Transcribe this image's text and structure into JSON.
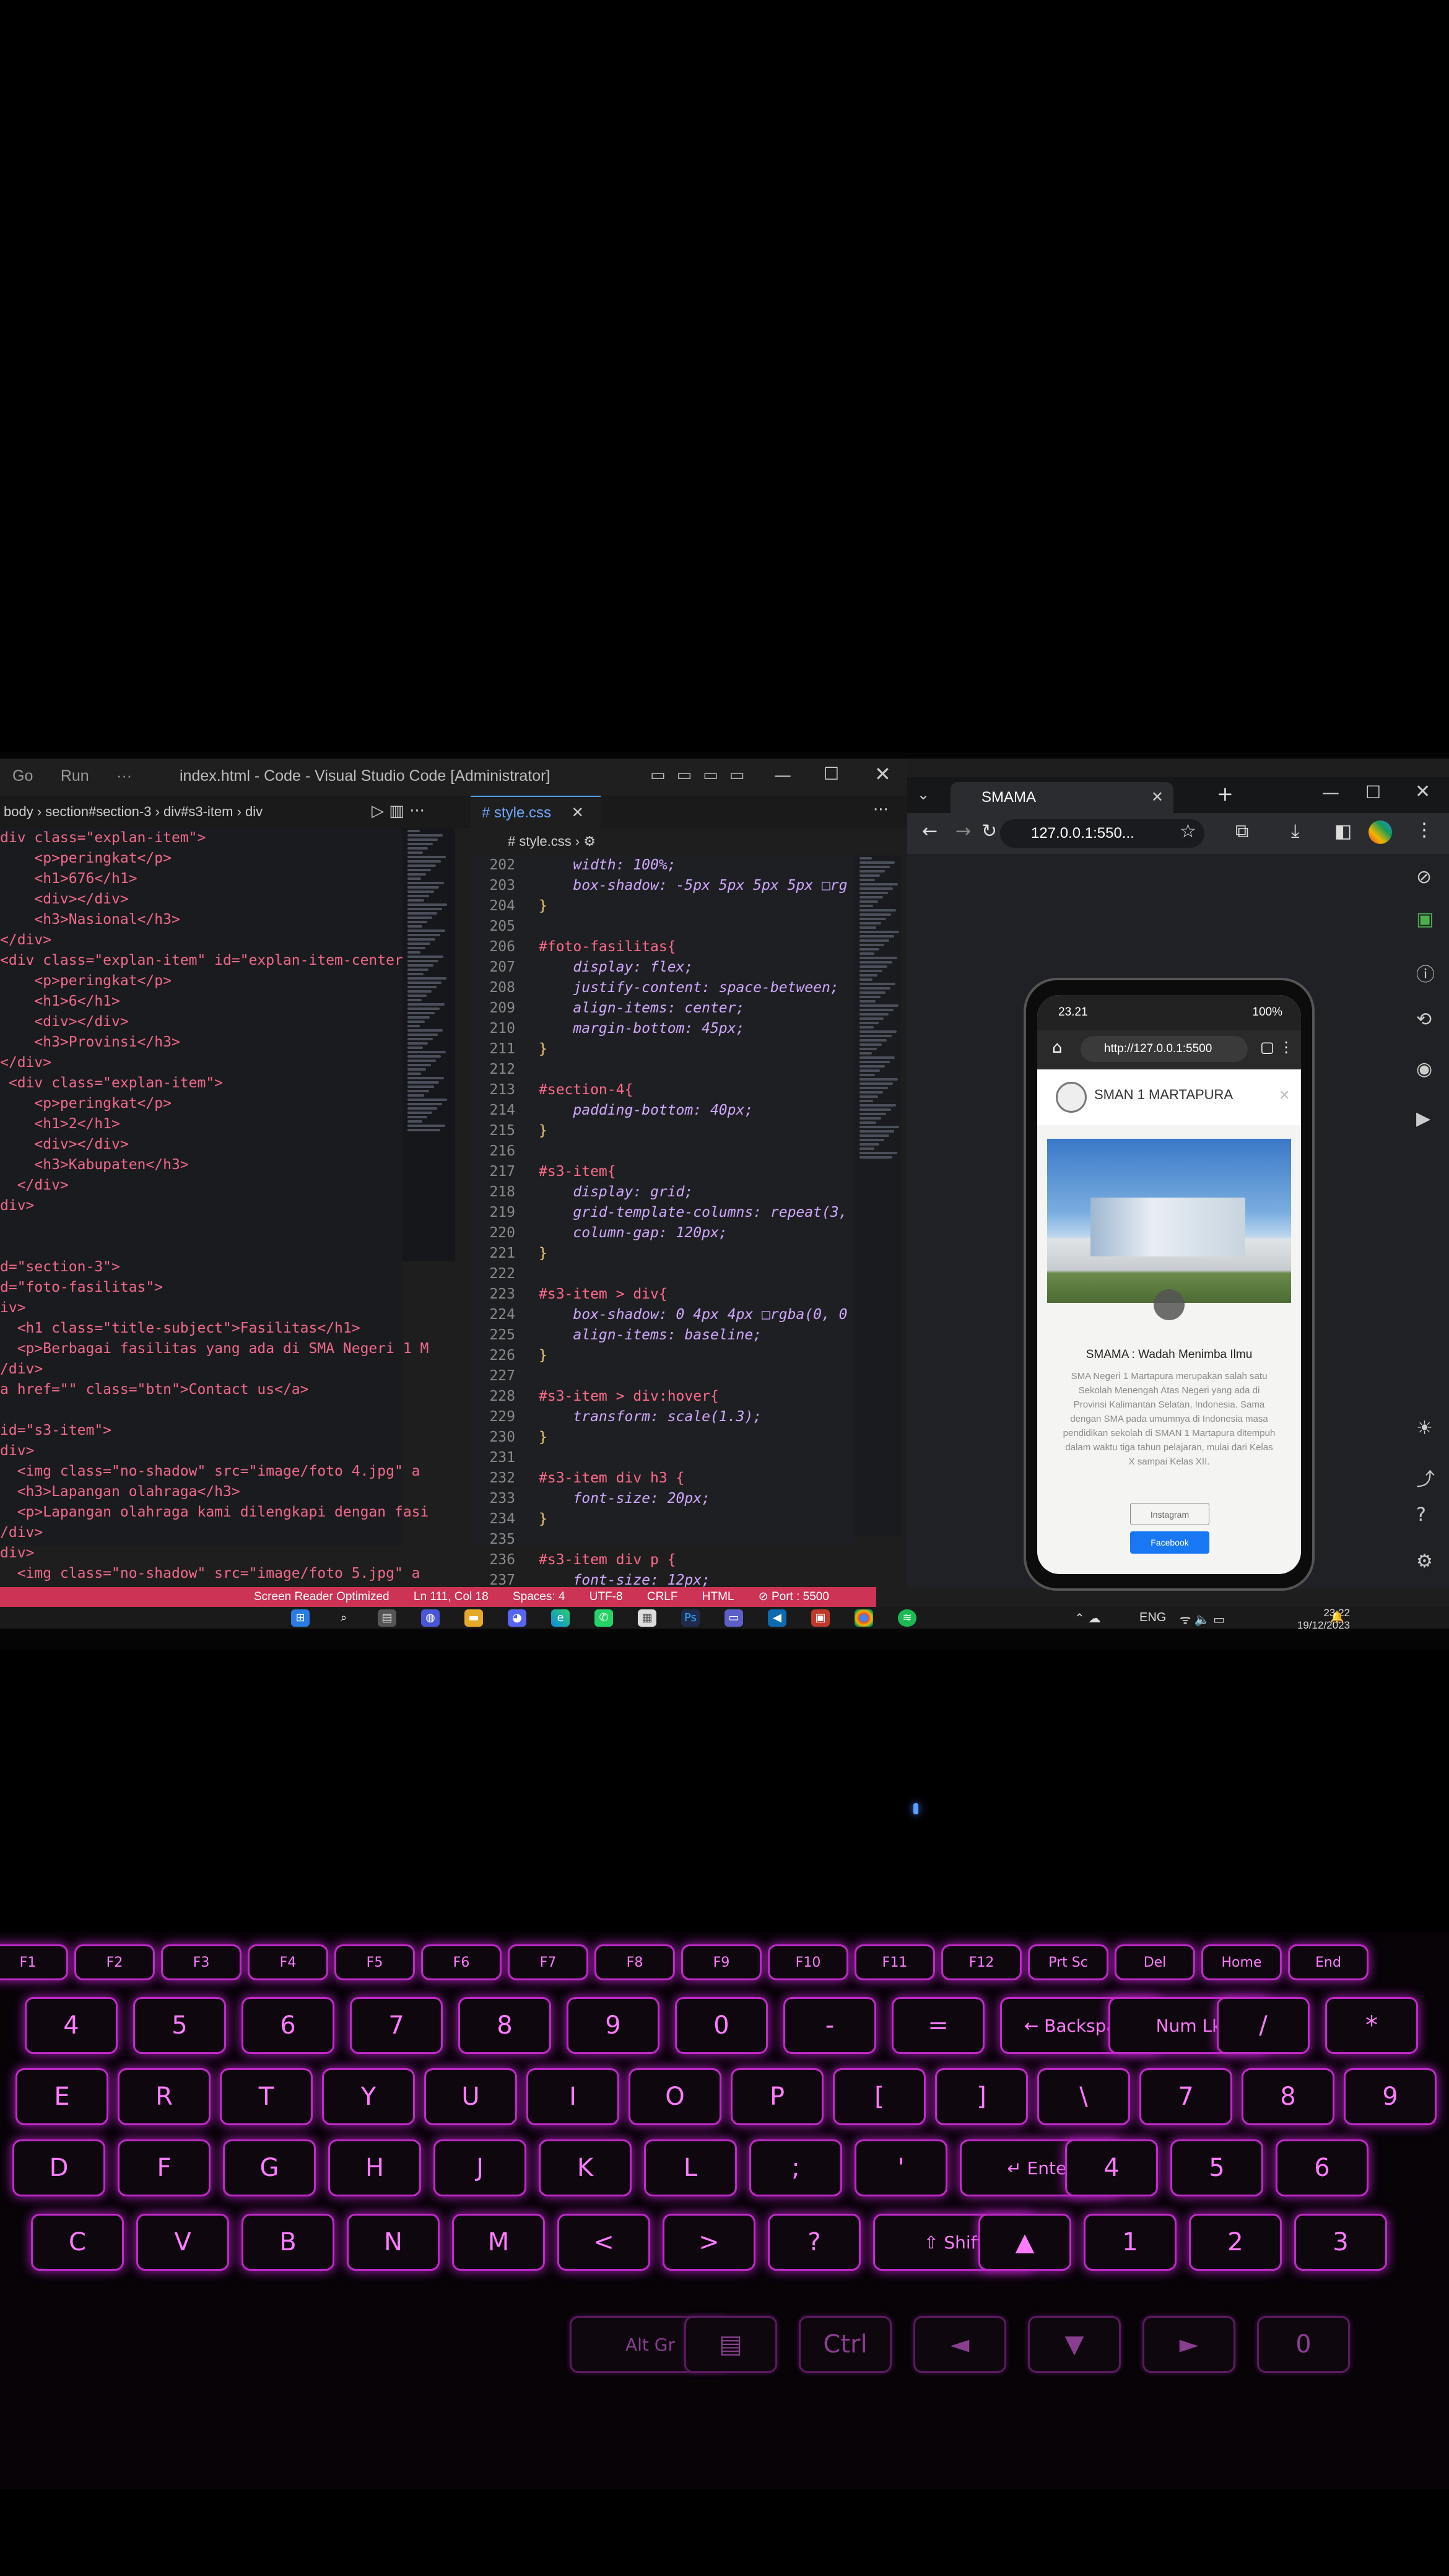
{
  "vscode": {
    "title": "index.html - Code - Visual Studio Code [Administrator]",
    "menu": [
      "Go",
      "Run",
      "···"
    ],
    "breadcrumb": "body › section#section-3 › div#s3-item › div",
    "html_lines": [
      "div class=\"explan-item\">",
      "    <p>peringkat</p>",
      "    <h1>676</h1>",
      "    <div></div>",
      "    <h3>Nasional</h3>",
      "</div>",
      "<div class=\"explan-item\" id=\"explan-item-center\"",
      "    <p>peringkat</p>",
      "    <h1>6</h1>",
      "    <div></div>",
      "    <h3>Provinsi</h3>",
      "</div>",
      " <div class=\"explan-item\">",
      "    <p>peringkat</p>",
      "    <h1>2</h1>",
      "    <div></div>",
      "    <h3>Kabupaten</h3>",
      "  </div>",
      "div>",
      "",
      "",
      "d=\"section-3\">",
      "d=\"foto-fasilitas\">",
      "iv>",
      "  <h1 class=\"title-subject\">Fasilitas</h1>",
      "  <p>Berbagai fasilitas yang ada di SMA Negeri 1 M",
      "/div>",
      "a href=\"\" class=\"btn\">Contact us</a>",
      "",
      "id=\"s3-item\">",
      "div>",
      "  <img class=\"no-shadow\" src=\"image/foto 4.jpg\" a",
      "  <h3>Lapangan olahraga</h3>",
      "  <p>Lapangan olahraga kami dilengkapi dengan fasi",
      "/div>",
      "div>",
      "  <img class=\"no-shadow\" src=\"image/foto 5.jpg\" a"
    ],
    "css_tab": "style.css",
    "css_breadcrumb": "# style.css › ⚙",
    "css_lines": [
      {
        "n": "202",
        "t": "    width: 100%;"
      },
      {
        "n": "203",
        "t": "    box-shadow: -5px 5px 5px 5px □rg"
      },
      {
        "n": "204",
        "t": "}"
      },
      {
        "n": "205",
        "t": ""
      },
      {
        "n": "206",
        "t": "#foto-fasilitas{"
      },
      {
        "n": "207",
        "t": "    display: flex;"
      },
      {
        "n": "208",
        "t": "    justify-content: space-between;"
      },
      {
        "n": "209",
        "t": "    align-items: center;"
      },
      {
        "n": "210",
        "t": "    margin-bottom: 45px;"
      },
      {
        "n": "211",
        "t": "}"
      },
      {
        "n": "212",
        "t": ""
      },
      {
        "n": "213",
        "t": "#section-4{"
      },
      {
        "n": "214",
        "t": "    padding-bottom: 40px;"
      },
      {
        "n": "215",
        "t": "}"
      },
      {
        "n": "216",
        "t": ""
      },
      {
        "n": "217",
        "t": "#s3-item{"
      },
      {
        "n": "218",
        "t": "    display: grid;"
      },
      {
        "n": "219",
        "t": "    grid-template-columns: repeat(3,"
      },
      {
        "n": "220",
        "t": "    column-gap: 120px;"
      },
      {
        "n": "221",
        "t": "}"
      },
      {
        "n": "222",
        "t": ""
      },
      {
        "n": "223",
        "t": "#s3-item > div{"
      },
      {
        "n": "224",
        "t": "    box-shadow: 0 4px 4px □rgba(0, 0"
      },
      {
        "n": "225",
        "t": "    align-items: baseline;"
      },
      {
        "n": "226",
        "t": "}"
      },
      {
        "n": "227",
        "t": ""
      },
      {
        "n": "228",
        "t": "#s3-item > div:hover{"
      },
      {
        "n": "229",
        "t": "    transform: scale(1.3);"
      },
      {
        "n": "230",
        "t": "}"
      },
      {
        "n": "231",
        "t": ""
      },
      {
        "n": "232",
        "t": "#s3-item div h3 {"
      },
      {
        "n": "233",
        "t": "    font-size: 20px;"
      },
      {
        "n": "234",
        "t": "}"
      },
      {
        "n": "235",
        "t": ""
      },
      {
        "n": "236",
        "t": "#s3-item div p {"
      },
      {
        "n": "237",
        "t": "    font-size: 12px;"
      },
      {
        "n": "238",
        "t": "}"
      }
    ],
    "status": [
      "Screen Reader Optimized",
      "Ln 111, Col 18",
      "Spaces: 4",
      "UTF-8",
      "CRLF",
      "HTML",
      "⊘ Port : 5500"
    ]
  },
  "chrome": {
    "tab_title": "SMAMA",
    "url": "127.0.0.1:550...",
    "phone": {
      "time": "23.21",
      "battery": "100%",
      "url": "http://127.0.0.1:5500",
      "site_name": "SMAN 1 MARTAPURA",
      "tagline": "SMAMA : Wadah Menimba Ilmu",
      "description": "SMA Negeri 1 Martapura merupakan salah satu Sekolah Menengah Atas Negeri yang ada di Provinsi Kalimantan Selatan, Indonesia. Sama dengan SMA pada umumnya di Indonesia masa pendidikan sekolah di SMAN 1 Martapura ditempuh dalam waktu tiga tahun pelajaran, mulai dari Kelas X sampai Kelas XII.",
      "btn_instagram": "Instagram",
      "btn_facebook": "Facebook"
    }
  },
  "taskbar": {
    "lang": "ENG",
    "time": "23:22",
    "date": "19/12/2023"
  },
  "keyboard": {
    "row1": [
      "F1",
      "F2",
      "F3",
      "F4",
      "F5",
      "F6",
      "F7",
      "F8",
      "F9",
      "F10",
      "F11",
      "F12",
      "Prt Sc",
      "Del",
      "Home",
      "End"
    ],
    "row2": [
      "4",
      "5",
      "6",
      "7",
      "8",
      "9",
      "0",
      "-",
      "=",
      "← Backspace",
      "Num Lk",
      "/",
      "*"
    ],
    "row3": [
      "E",
      "R",
      "T",
      "Y",
      "U",
      "I",
      "O",
      "P",
      "[",
      "]",
      "\\",
      "7",
      "8",
      "9"
    ],
    "row4": [
      "D",
      "F",
      "G",
      "H",
      "J",
      "K",
      "L",
      ";",
      "'",
      "↵ Enter",
      "4",
      "5",
      "6"
    ],
    "row5": [
      "C",
      "V",
      "B",
      "N",
      "M",
      "<",
      ">",
      "?",
      "⇧ Shift",
      "▲",
      "1",
      "2",
      "3"
    ],
    "row6": [
      "Alt Gr",
      "▤",
      "Ctrl",
      "◄",
      "▼",
      "►",
      "0"
    ]
  }
}
